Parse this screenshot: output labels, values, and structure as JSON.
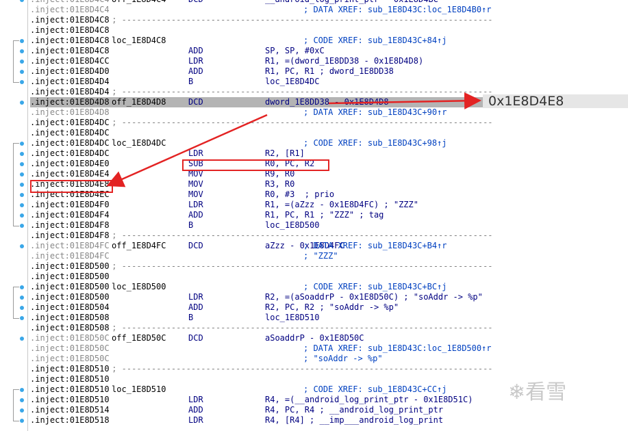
{
  "annotation": {
    "hex": "0x1E8D4E8"
  },
  "watermark": {
    "glyph": "❄",
    "text": "看雪"
  },
  "rows": [
    {
      "addr": ".inject:01E8D4C4",
      "gray": true,
      "label": "off_1E8D4C4",
      "mn": "DCD",
      "op": "__android_log_print_ptr - 0x1E8D4BC",
      "cm": ""
    },
    {
      "addr": ".inject:01E8D4C4",
      "gray": true,
      "label": "",
      "mn": "",
      "op": "",
      "cm": "; DATA XREF: sub_1E8D43C:loc_1E8D4B0↑r"
    },
    {
      "addr": ".inject:01E8D4C8",
      "gray": false,
      "sep": " ; ---------------------------------------------------------------------------"
    },
    {
      "addr": ".inject:01E8D4C8",
      "gray": false,
      "label": "",
      "mn": "",
      "op": "",
      "cm": ""
    },
    {
      "addr": ".inject:01E8D4C8",
      "gray": false,
      "label": "loc_1E8D4C8",
      "mn": "",
      "op": "",
      "cm": "; CODE XREF: sub_1E8D43C+84↑j"
    },
    {
      "addr": ".inject:01E8D4C8",
      "gray": false,
      "label": "",
      "mn": "ADD",
      "op": "SP, SP, #0xC",
      "cm": ""
    },
    {
      "addr": ".inject:01E8D4CC",
      "gray": false,
      "label": "",
      "mn": "LDR",
      "op": "R1, =(dword_1E8DD38 - 0x1E8D4D8)",
      "cm": ""
    },
    {
      "addr": ".inject:01E8D4D0",
      "gray": false,
      "label": "",
      "mn": "ADD",
      "op": "R1, PC, R1 ; dword_1E8DD38",
      "cm": ""
    },
    {
      "addr": ".inject:01E8D4D4",
      "gray": false,
      "label": "",
      "mn": "B",
      "op": "loc_1E8D4DC",
      "cm": ""
    },
    {
      "addr": ".inject:01E8D4D4",
      "gray": false,
      "sep": " ; ---------------------------------------------------------------------------"
    },
    {
      "addr": ".inject:01E8D4D8",
      "gray": false,
      "sel": true,
      "label": "off_1E8D4D8",
      "mn": "DCD",
      "op": "dword_1E8DD38 - 0x1E8D4D8",
      "cm": ""
    },
    {
      "addr": ".inject:01E8D4D8",
      "gray": true,
      "label": "",
      "mn": "",
      "op": "",
      "cm": "; DATA XREF: sub_1E8D43C+90↑r"
    },
    {
      "addr": ".inject:01E8D4DC",
      "gray": false,
      "sep": " ; ---------------------------------------------------------------------------"
    },
    {
      "addr": ".inject:01E8D4DC",
      "gray": false,
      "label": "",
      "mn": "",
      "op": "",
      "cm": ""
    },
    {
      "addr": ".inject:01E8D4DC",
      "gray": false,
      "label": "loc_1E8D4DC",
      "mn": "",
      "op": "",
      "cm": "; CODE XREF: sub_1E8D43C+98↑j"
    },
    {
      "addr": ".inject:01E8D4DC",
      "gray": false,
      "label": "",
      "mn": "LDR",
      "op": "R2, [R1]",
      "cm": ""
    },
    {
      "addr": ".inject:01E8D4E0",
      "gray": false,
      "label": "",
      "mn": "SUB",
      "op": "R0, PC, R2",
      "cm": ""
    },
    {
      "addr": ".inject:01E8D4E4",
      "gray": false,
      "label": "",
      "mn": "MOV",
      "op": "R9, R0",
      "cm": ""
    },
    {
      "addr": ".inject:01E8D4E8",
      "gray": false,
      "label": "",
      "mn": "MOV",
      "op": "R3, R0",
      "cm": ""
    },
    {
      "addr": ".inject:01E8D4EC",
      "gray": false,
      "label": "",
      "mn": "MOV",
      "op": "R0, #3  ; prio",
      "cm": ""
    },
    {
      "addr": ".inject:01E8D4F0",
      "gray": false,
      "label": "",
      "mn": "LDR",
      "op": "R1, =(aZzz - 0x1E8D4FC) ; \"ZZZ\"",
      "cm": ""
    },
    {
      "addr": ".inject:01E8D4F4",
      "gray": false,
      "label": "",
      "mn": "ADD",
      "op": "R1, PC, R1 ; \"ZZZ\" ; tag",
      "cm": ""
    },
    {
      "addr": ".inject:01E8D4F8",
      "gray": false,
      "label": "",
      "mn": "B",
      "op": "loc_1E8D500",
      "cm": ""
    },
    {
      "addr": ".inject:01E8D4F8",
      "gray": false,
      "sep": " ; ---------------------------------------------------------------------------"
    },
    {
      "addr": ".inject:01E8D4FC",
      "gray": true,
      "label": "off_1E8D4FC",
      "mn": "DCD",
      "op": "aZzz - 0x1E8D4FC",
      "cm": "; DATA XREF: sub_1E8D43C+B4↑r"
    },
    {
      "addr": ".inject:01E8D4FC",
      "gray": true,
      "label": "",
      "mn": "",
      "op": "",
      "cm": "; \"ZZZ\""
    },
    {
      "addr": ".inject:01E8D500",
      "gray": false,
      "sep": " ; ---------------------------------------------------------------------------"
    },
    {
      "addr": ".inject:01E8D500",
      "gray": false,
      "label": "",
      "mn": "",
      "op": "",
      "cm": ""
    },
    {
      "addr": ".inject:01E8D500",
      "gray": false,
      "label": "loc_1E8D500",
      "mn": "",
      "op": "",
      "cm": "; CODE XREF: sub_1E8D43C+BC↑j"
    },
    {
      "addr": ".inject:01E8D500",
      "gray": false,
      "label": "",
      "mn": "LDR",
      "op": "R2, =(aSoaddrP - 0x1E8D50C) ; \"soAddr -> %p\"",
      "cm": ""
    },
    {
      "addr": ".inject:01E8D504",
      "gray": false,
      "label": "",
      "mn": "ADD",
      "op": "R2, PC, R2 ; \"soAddr -> %p\"",
      "cm": ""
    },
    {
      "addr": ".inject:01E8D508",
      "gray": false,
      "label": "",
      "mn": "B",
      "op": "loc_1E8D510",
      "cm": ""
    },
    {
      "addr": ".inject:01E8D508",
      "gray": false,
      "sep": " ; ---------------------------------------------------------------------------"
    },
    {
      "addr": ".inject:01E8D50C",
      "gray": true,
      "label": "off_1E8D50C",
      "mn": "DCD",
      "op": "aSoaddrP - 0x1E8D50C",
      "cm": ""
    },
    {
      "addr": ".inject:01E8D50C",
      "gray": true,
      "label": "",
      "mn": "",
      "op": "",
      "cm": "; DATA XREF: sub_1E8D43C:loc_1E8D500↑r"
    },
    {
      "addr": ".inject:01E8D50C",
      "gray": true,
      "label": "",
      "mn": "",
      "op": "",
      "cm": "; \"soAddr -> %p\""
    },
    {
      "addr": ".inject:01E8D510",
      "gray": false,
      "sep": " ; ---------------------------------------------------------------------------"
    },
    {
      "addr": ".inject:01E8D510",
      "gray": false,
      "label": "",
      "mn": "",
      "op": "",
      "cm": ""
    },
    {
      "addr": ".inject:01E8D510",
      "gray": false,
      "label": "loc_1E8D510",
      "mn": "",
      "op": "",
      "cm": "; CODE XREF: sub_1E8D43C+CC↑j"
    },
    {
      "addr": ".inject:01E8D510",
      "gray": false,
      "label": "",
      "mn": "LDR",
      "op": "R4, =(__android_log_print_ptr - 0x1E8D51C)",
      "cm": ""
    },
    {
      "addr": ".inject:01E8D514",
      "gray": false,
      "label": "",
      "mn": "ADD",
      "op": "R4, PC, R4 ; __android_log_print_ptr",
      "cm": ""
    },
    {
      "addr": ".inject:01E8D518",
      "gray": false,
      "label": "",
      "mn": "LDR",
      "op": "R4, [R4] ; __imp___android_log_print",
      "cm": ""
    }
  ]
}
